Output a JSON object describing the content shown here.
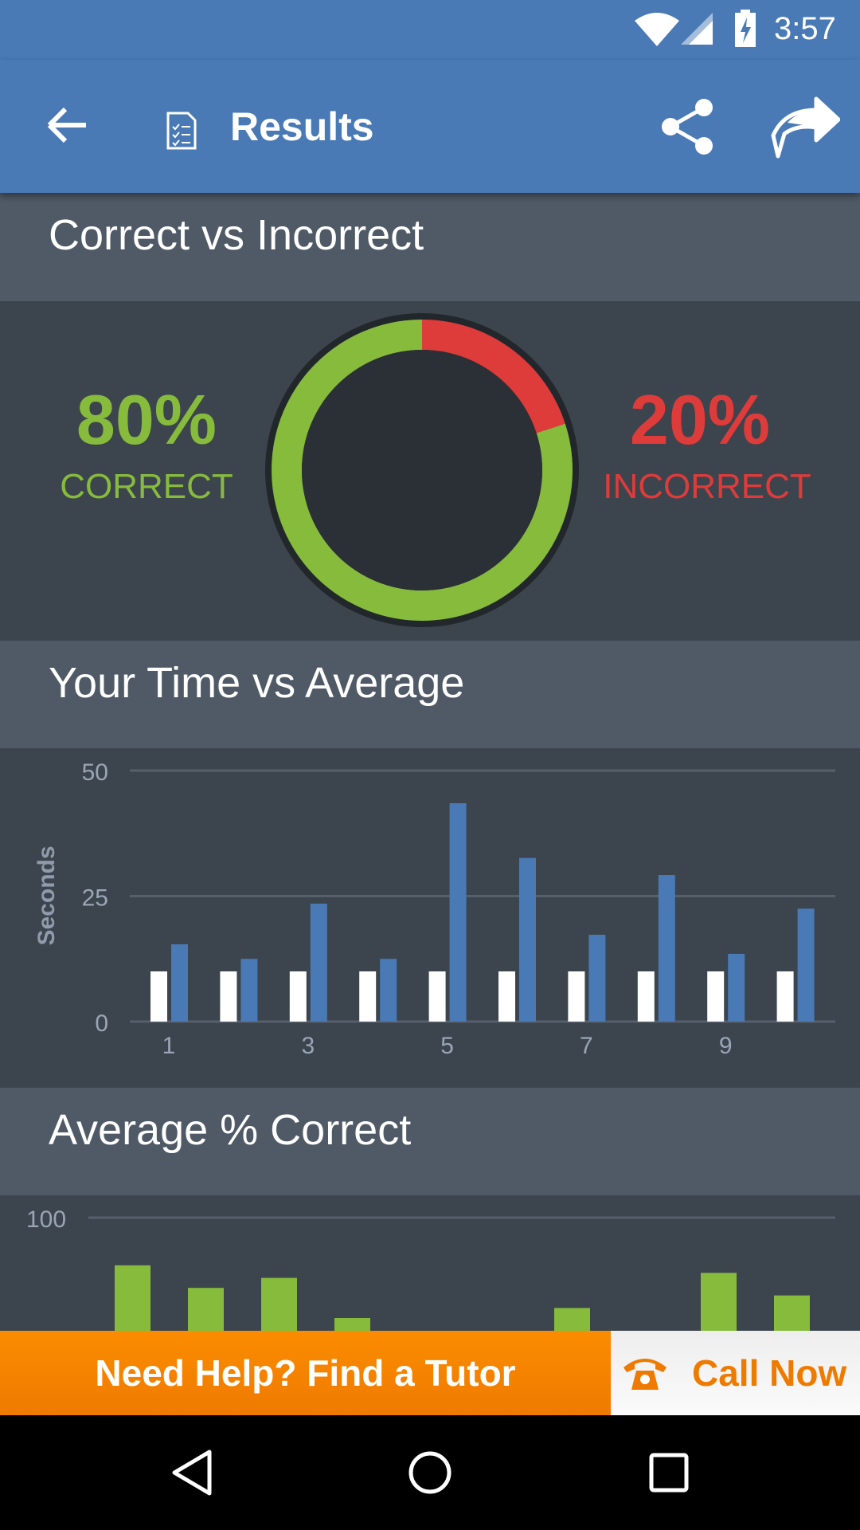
{
  "status_bar": {
    "time": "3:57",
    "icons": [
      "wifi-icon",
      "signal-icon",
      "battery-charging-icon"
    ]
  },
  "app_bar": {
    "title": "Results",
    "icons": [
      "back-arrow-icon",
      "document-checklist-icon",
      "share-icon",
      "forward-arrow-icon"
    ],
    "color": "#4a7ab5"
  },
  "correct_section": {
    "title": "Correct vs Incorrect",
    "correct_pct": "80%",
    "correct_label": "CORRECT",
    "incorrect_pct": "20%",
    "incorrect_label": "INCORRECT",
    "correct_fraction": 0.8,
    "colors": {
      "correct": "#86bb3c",
      "incorrect": "#de3b3b"
    }
  },
  "time_section": {
    "title": "Your Time vs Average"
  },
  "avg_section": {
    "title": "Average % Correct"
  },
  "chart_data": [
    {
      "type": "bar",
      "ylabel": "Seconds",
      "ylim": [
        0,
        50
      ],
      "yticks": [
        "0",
        "25",
        "50"
      ],
      "categories": [
        "1",
        "2",
        "3",
        "4",
        "5",
        "6",
        "7",
        "8",
        "9",
        "10"
      ],
      "xtick_labels": [
        "1",
        "3",
        "5",
        "7",
        "9"
      ],
      "grid": true,
      "series": [
        {
          "color": "#ffffff",
          "values": [
            10,
            10,
            10,
            10,
            10,
            10,
            10,
            10,
            10,
            10
          ]
        },
        {
          "color": "#4a7ab5",
          "values": [
            15.4,
            12.5,
            23.5,
            12.5,
            43.5,
            32.6,
            17.3,
            29.2,
            13.5,
            22.5
          ]
        }
      ]
    },
    {
      "type": "bar",
      "ylim": [
        0,
        100
      ],
      "yticks": [
        "100"
      ],
      "categories": [
        "1",
        "2",
        "3",
        "4",
        "5",
        "6",
        "7",
        "8",
        "9",
        "10"
      ],
      "grid": true,
      "series": [
        {
          "color": "#86bb3c",
          "values": [
            81,
            72,
            76,
            60,
            0,
            0,
            64,
            0,
            78,
            69
          ]
        }
      ]
    }
  ],
  "banner": {
    "left_text": "Need Help? Find a Tutor",
    "right_text": "Call Now",
    "icon": "telephone-icon"
  },
  "nav_bar": {
    "icons": [
      "back-triangle-icon",
      "home-circle-icon",
      "recents-square-icon"
    ]
  }
}
